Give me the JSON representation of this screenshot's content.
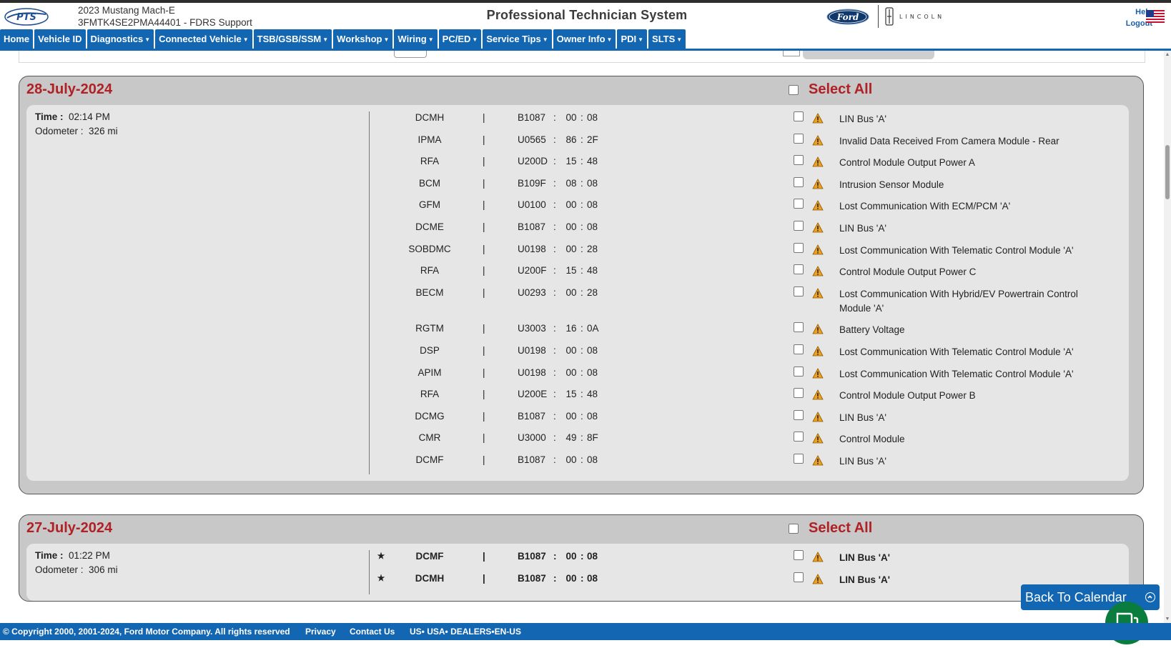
{
  "header": {
    "logo_text": "PTS",
    "vehicle_model": "2023 Mustang Mach-E",
    "vehicle_vin": "3FMTK4SE2PMA44401 - FDRS Support",
    "app_title": "Professional Technician System",
    "ford_logo_text": "Ford",
    "lincoln_logo_text": "LINCOLN",
    "help_label": "Help",
    "logout_label": "Logout"
  },
  "nav": {
    "items": [
      {
        "label": "Home",
        "dropdown": false
      },
      {
        "label": "Vehicle ID",
        "dropdown": false
      },
      {
        "label": "Diagnostics",
        "dropdown": true
      },
      {
        "label": "Connected Vehicle",
        "dropdown": true
      },
      {
        "label": "TSB/GSB/SSM",
        "dropdown": true
      },
      {
        "label": "Workshop",
        "dropdown": true
      },
      {
        "label": "Wiring",
        "dropdown": true
      },
      {
        "label": "PC/ED",
        "dropdown": true
      },
      {
        "label": "Service Tips",
        "dropdown": true
      },
      {
        "label": "Owner Info",
        "dropdown": true
      },
      {
        "label": "PDI",
        "dropdown": true
      },
      {
        "label": "SLTS",
        "dropdown": true
      }
    ]
  },
  "days": [
    {
      "date": "28-July-2024",
      "select_all_label": "Select All",
      "time_label": "Time :",
      "time_value": "02:14 PM",
      "odometer_label": "Odometer :",
      "odometer_value": "326 mi",
      "dtcs": [
        {
          "module": "DCMH",
          "code": "B1087",
          "byte1": "00",
          "byte2": "08",
          "desc": "LIN Bus 'A'"
        },
        {
          "module": "IPMA",
          "code": "U0565",
          "byte1": "86",
          "byte2": "2F",
          "desc": "Invalid Data Received From Camera Module - Rear"
        },
        {
          "module": "RFA",
          "code": "U200D",
          "byte1": "15",
          "byte2": "48",
          "desc": "Control Module Output Power A"
        },
        {
          "module": "BCM",
          "code": "B109F",
          "byte1": "08",
          "byte2": "08",
          "desc": "Intrusion Sensor Module"
        },
        {
          "module": "GFM",
          "code": "U0100",
          "byte1": "00",
          "byte2": "08",
          "desc": "Lost Communication With ECM/PCM 'A'"
        },
        {
          "module": "DCME",
          "code": "B1087",
          "byte1": "00",
          "byte2": "08",
          "desc": "LIN Bus 'A'"
        },
        {
          "module": "SOBDMC",
          "code": "U0198",
          "byte1": "00",
          "byte2": "28",
          "desc": "Lost Communication With Telematic Control Module 'A'"
        },
        {
          "module": "RFA",
          "code": "U200F",
          "byte1": "15",
          "byte2": "48",
          "desc": "Control Module Output Power C"
        },
        {
          "module": "BECM",
          "code": "U0293",
          "byte1": "00",
          "byte2": "28",
          "desc": "Lost Communication With Hybrid/EV Powertrain Control Module 'A'"
        },
        {
          "module": "RGTM",
          "code": "U3003",
          "byte1": "16",
          "byte2": "0A",
          "desc": "Battery Voltage"
        },
        {
          "module": "DSP",
          "code": "U0198",
          "byte1": "00",
          "byte2": "08",
          "desc": "Lost Communication With Telematic Control Module 'A'"
        },
        {
          "module": "APIM",
          "code": "U0198",
          "byte1": "00",
          "byte2": "08",
          "desc": "Lost Communication With Telematic Control Module 'A'"
        },
        {
          "module": "RFA",
          "code": "U200E",
          "byte1": "15",
          "byte2": "48",
          "desc": "Control Module Output Power B"
        },
        {
          "module": "DCMG",
          "code": "B1087",
          "byte1": "00",
          "byte2": "08",
          "desc": "LIN Bus 'A'"
        },
        {
          "module": "CMR",
          "code": "U3000",
          "byte1": "49",
          "byte2": "8F",
          "desc": "Control Module"
        },
        {
          "module": "DCMF",
          "code": "B1087",
          "byte1": "00",
          "byte2": "08",
          "desc": "LIN Bus 'A'"
        }
      ]
    },
    {
      "date": "27-July-2024",
      "select_all_label": "Select All",
      "time_label": "Time :",
      "time_value": "01:22 PM",
      "odometer_label": "Odometer :",
      "odometer_value": "306 mi",
      "dtcs": [
        {
          "module": "DCMF",
          "code": "B1087",
          "byte1": "00",
          "byte2": "08",
          "desc": "LIN Bus 'A'",
          "starred": true
        },
        {
          "module": "DCMH",
          "code": "B1087",
          "byte1": "00",
          "byte2": "08",
          "desc": "LIN Bus 'A'",
          "starred": true
        }
      ]
    }
  ],
  "floating": {
    "back_to_calendar": "Back To Calendar"
  },
  "footer": {
    "copyright": "© Copyright 2000, 2001-2024, Ford Motor Company. All rights reserved",
    "privacy": "Privacy",
    "contact": "Contact Us",
    "locale": "US• USA• DEALERS•EN-US"
  },
  "colors": {
    "nav_blue": "#1366b1",
    "date_red": "#b02025",
    "warning_orange": "#f0a020",
    "chat_green": "#0a7d3e"
  },
  "icons": [
    "pts-logo",
    "ford-logo",
    "lincoln-logo",
    "us-flag-icon",
    "caret-down-icon",
    "warning-icon",
    "star-icon",
    "chevron-up-icon",
    "chat-icon"
  ]
}
